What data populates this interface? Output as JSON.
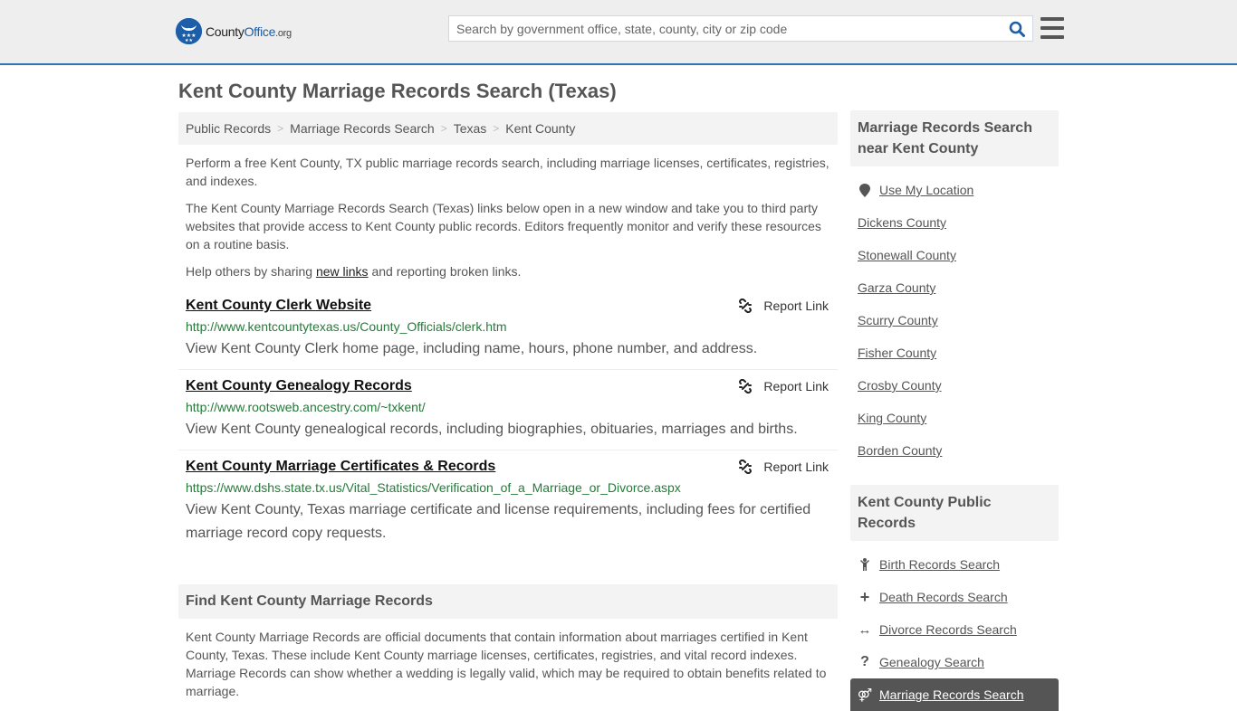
{
  "header": {
    "logo": {
      "part1": "County",
      "part2": "Office",
      "part3": ".org"
    },
    "search": {
      "placeholder": "Search by government office, state, county, city or zip code",
      "value": ""
    },
    "colors": {
      "accent": "#2f75b0",
      "brand": "#1c5ea8"
    }
  },
  "page": {
    "title": "Kent County Marriage Records Search (Texas)"
  },
  "breadcrumb": [
    {
      "label": "Public Records"
    },
    {
      "label": "Marriage Records Search"
    },
    {
      "label": "Texas"
    },
    {
      "label": "Kent County"
    }
  ],
  "intro": {
    "p1": "Perform a free Kent County, TX public marriage records search, including marriage licenses, certificates, registries, and indexes.",
    "p2": "The Kent County Marriage Records Search (Texas) links below open in a new window and take you to third party websites that provide access to Kent County public records. Editors frequently monitor and verify these resources on a routine basis.",
    "p3_before": "Help others by sharing ",
    "p3_link": "new links",
    "p3_after": " and reporting broken links."
  },
  "results": [
    {
      "title": "Kent County Clerk Website",
      "url": "http://www.kentcountytexas.us/County_Officials/clerk.htm",
      "description": "View Kent County Clerk home page, including name, hours, phone number, and address.",
      "report_label": "Report Link"
    },
    {
      "title": "Kent County Genealogy Records",
      "url": "http://www.rootsweb.ancestry.com/~txkent/",
      "description": "View Kent County genealogical records, including biographies, obituaries, marriages and births.",
      "report_label": "Report Link"
    },
    {
      "title": "Kent County Marriage Certificates & Records",
      "url": "https://www.dshs.state.tx.us/Vital_Statistics/Verification_of_a_Marriage_or_Divorce.aspx",
      "description": "View Kent County, Texas marriage certificate and license requirements, including fees for certified marriage record copy requests.",
      "report_label": "Report Link"
    }
  ],
  "find_section": {
    "title": "Find Kent County Marriage Records",
    "body": "Kent County Marriage Records are official documents that contain information about marriages certified in Kent County, Texas. These include Kent County marriage licenses, certificates, registries, and vital record indexes. Marriage Records can show whether a wedding is legally valid, which may be required to obtain benefits related to marriage."
  },
  "sidebar": {
    "nearby_title": "Marriage Records Search near Kent County",
    "use_location": {
      "label": "Use My Location",
      "icon": "map-marker-icon"
    },
    "nearby": [
      {
        "label": "Dickens County"
      },
      {
        "label": "Stonewall County"
      },
      {
        "label": "Garza County"
      },
      {
        "label": "Scurry County"
      },
      {
        "label": "Fisher County"
      },
      {
        "label": "Crosby County"
      },
      {
        "label": "King County"
      },
      {
        "label": "Borden County"
      }
    ],
    "public_title": "Kent County Public Records",
    "public": [
      {
        "label": "Birth Records Search",
        "icon": "child-icon",
        "glyph": "Ÿ"
      },
      {
        "label": "Death Records Search",
        "icon": "plus-icon",
        "glyph": "+"
      },
      {
        "label": "Divorce Records Search",
        "icon": "arrows-h-icon",
        "glyph": "↔"
      },
      {
        "label": "Genealogy Search",
        "icon": "question-icon",
        "glyph": "?"
      }
    ],
    "active": {
      "label": "Marriage Records Search",
      "icon": "marriage-icon",
      "glyph": "⚤"
    }
  }
}
